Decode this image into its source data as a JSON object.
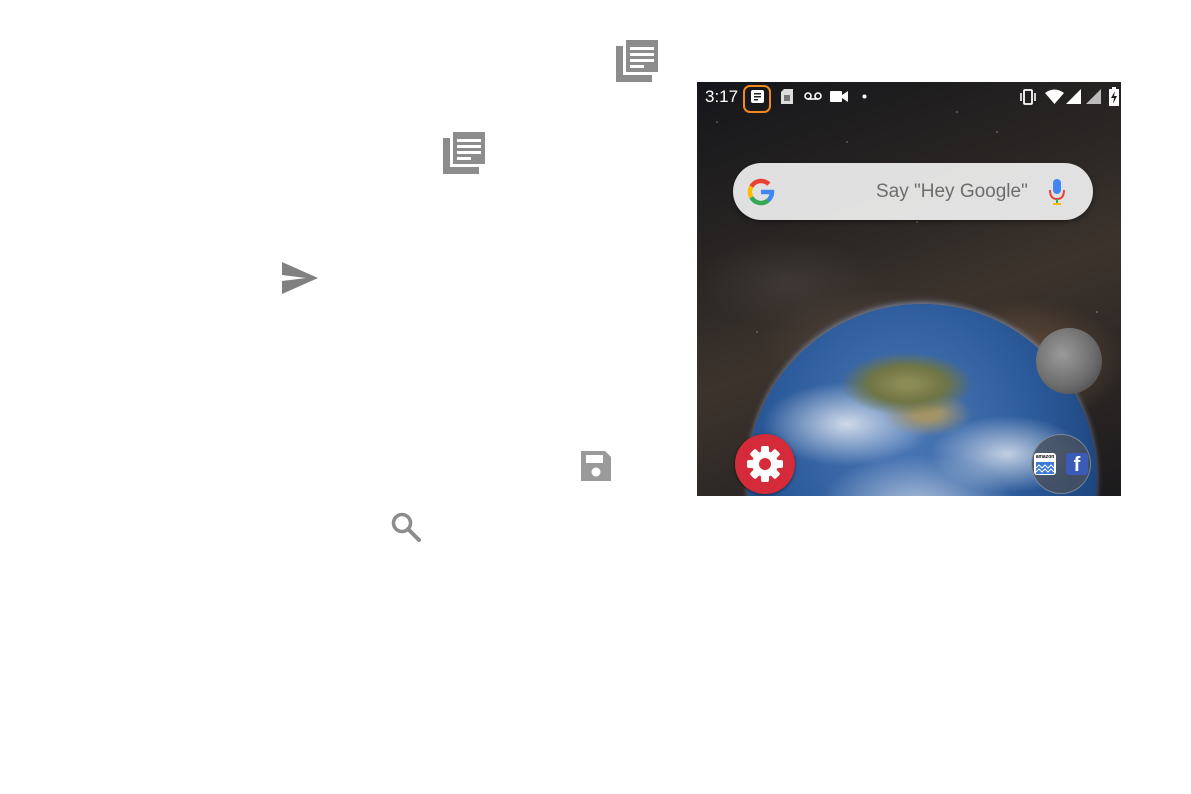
{
  "left_icons": [
    {
      "name": "news-article-icon",
      "color": "#8c8c8c"
    },
    {
      "name": "news-article-icon",
      "color": "#8c8c8c"
    },
    {
      "name": "send-icon",
      "color": "#808080"
    },
    {
      "name": "save-icon",
      "color": "#9a9a9a"
    },
    {
      "name": "search-icon",
      "color": "#8c8c8c"
    }
  ],
  "phone": {
    "status_bar": {
      "time": "3:17",
      "highlight_color": "#f08a1c",
      "left_icons": [
        "news-notification-icon",
        "sim-card-icon",
        "voicemail-icon",
        "video-camera-icon",
        "dot-icon"
      ],
      "right_icons": [
        "vibrate-icon",
        "wifi-icon",
        "signal-icon",
        "signal-icon",
        "battery-charging-icon"
      ]
    },
    "search_widget": {
      "hint": "Say \"Hey Google\"",
      "icons": [
        "google-g-icon",
        "microphone-icon"
      ]
    },
    "wallpaper": "earth-and-moon-space",
    "dock": {
      "settings_app": {
        "icon": "settings-gear-icon",
        "color": "#d52a3a"
      },
      "folder": {
        "apps": [
          "amazon-icon",
          "facebook-icon"
        ],
        "amazon_label": "amazon"
      }
    }
  }
}
